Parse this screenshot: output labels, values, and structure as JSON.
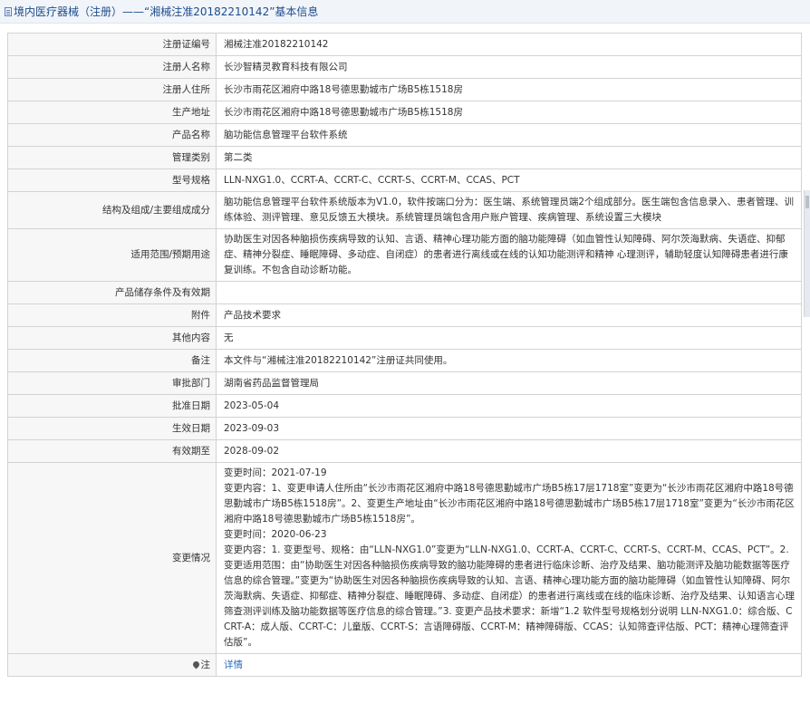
{
  "header": {
    "title": "境内医疗器械（注册）——“湘械注准20182210142”基本信息"
  },
  "rows": [
    {
      "label": "注册证编号",
      "value": "湘械注准20182210142"
    },
    {
      "label": "注册人名称",
      "value": "长沙智精灵教育科技有限公司"
    },
    {
      "label": "注册人住所",
      "value": "长沙市雨花区湘府中路18号德思勤城市广场B5栋1518房"
    },
    {
      "label": "生产地址",
      "value": "长沙市雨花区湘府中路18号德思勤城市广场B5栋1518房"
    },
    {
      "label": "产品名称",
      "value": "脑功能信息管理平台软件系统"
    },
    {
      "label": "管理类别",
      "value": "第二类"
    },
    {
      "label": "型号规格",
      "value": "LLN-NXG1.0、CCRT-A、CCRT-C、CCRT-S、CCRT-M、CCAS、PCT"
    },
    {
      "label": "结构及组成/主要组成成分",
      "value": "脑功能信息管理平台软件系统版本为V1.0，软件按端口分为：医生端、系统管理员端2个组成部分。医生端包含信息录入、患者管理、训练体验、测评管理、意见反馈五大模块。系统管理员端包含用户账户管理、疾病管理、系统设置三大模块"
    },
    {
      "label": "适用范围/预期用途",
      "value": "协助医生对因各种脑损伤疾病导致的认知、言语、精神心理功能方面的脑功能障碍（如血管性认知障碍、阿尔茨海默病、失语症、抑郁症、精神分裂症、睡眠障碍、多动症、自闭症）的患者进行离线或在线的认知功能测评和精神 心理测评，辅助轻度认知障碍患者进行康复训练。不包含自动诊断功能。"
    },
    {
      "label": "产品储存条件及有效期",
      "value": ""
    },
    {
      "label": "附件",
      "value": "产品技术要求"
    },
    {
      "label": "其他内容",
      "value": "无"
    },
    {
      "label": "备注",
      "value": "本文件与“湘械注准20182210142”注册证共同使用。"
    },
    {
      "label": "审批部门",
      "value": "湖南省药品监督管理局"
    },
    {
      "label": "批准日期",
      "value": "2023-05-04"
    },
    {
      "label": "生效日期",
      "value": "2023-09-03"
    },
    {
      "label": "有效期至",
      "value": "2028-09-02"
    }
  ],
  "changes": {
    "label": "变更情况",
    "lines": [
      "变更时间：2021-07-19",
      "变更内容：1、变更申请人住所由“长沙市雨花区湘府中路18号德思勤城市广场B5栋17层1718室”变更为“长沙市雨花区湘府中路18号德思勤城市广场B5栋1518房”。2、变更生产地址由“长沙市雨花区湘府中路18号德思勤城市广场B5栋17层1718室”变更为“长沙市雨花区湘府中路18号德思勤城市广场B5栋1518房”。",
      "变更时间：2020-06-23",
      "变更内容：1. 变更型号、规格：由“LLN-NXG1.0”变更为“LLN-NXG1.0、CCRT-A、CCRT-C、CCRT-S、CCRT-M、CCAS、PCT”。2. 变更适用范围：由“协助医生对因各种脑损伤疾病导致的脑功能障碍的患者进行临床诊断、治疗及结果、脑功能测评及脑功能数据等医疗信息的综合管理。”变更为“协助医生对因各种脑损伤疾病导致的认知、言语、精神心理功能方面的脑功能障碍（如血管性认知障碍、阿尔茨海默病、失语症、抑郁症、精神分裂症、睡眠障碍、多动症、自闭症）的患者进行离线或在线的临床诊断、治疗及结果、认知语言心理筛查测评训练及脑功能数据等医疗信息的综合管理。”3. 变更产品技术要求：新增“1.2 软件型号规格划分说明 LLN-NXG1.0：综合版、CCRT-A：成人版、CCRT-C：儿童版、CCRT-S：言语障碍版、CCRT-M：精神障碍版、CCAS：认知筛查评估版、PCT：精神心理筛查评估版”。"
    ]
  },
  "note": {
    "label": "注",
    "icon": "pin-icon",
    "link_text": "详情"
  },
  "colors": {
    "header_bg": "#f1f4f9",
    "header_text": "#1c4c8c",
    "label_bg": "#f7f7f7",
    "border": "#d3d3d3",
    "link": "#2a6cc4"
  }
}
